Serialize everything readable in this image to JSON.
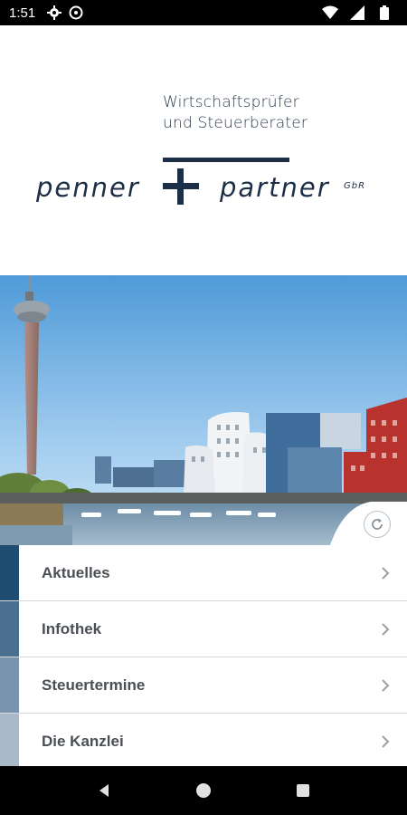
{
  "statusbar": {
    "time": "1:51"
  },
  "header": {
    "tagline_line1": "Wirtschaftsprüfer",
    "tagline_line2": "und Steuerberater",
    "logo_left": "penner",
    "logo_right": "partner",
    "logo_suffix": "GbR"
  },
  "menu": {
    "items": [
      {
        "label": "Aktuelles",
        "color": "#1f4d72"
      },
      {
        "label": "Infothek",
        "color": "#4b6f8e"
      },
      {
        "label": "Steuertermine",
        "color": "#7895ad"
      },
      {
        "label": "Die Kanzlei",
        "color": "#a9b9c7"
      }
    ]
  },
  "colors": {
    "brand": "#1d2f47",
    "text": "#4a4f55"
  },
  "icons": {
    "refresh": "refresh-icon",
    "chevron": "chevron-right-icon",
    "back": "back-icon",
    "home": "home-icon",
    "recents": "recents-icon"
  }
}
